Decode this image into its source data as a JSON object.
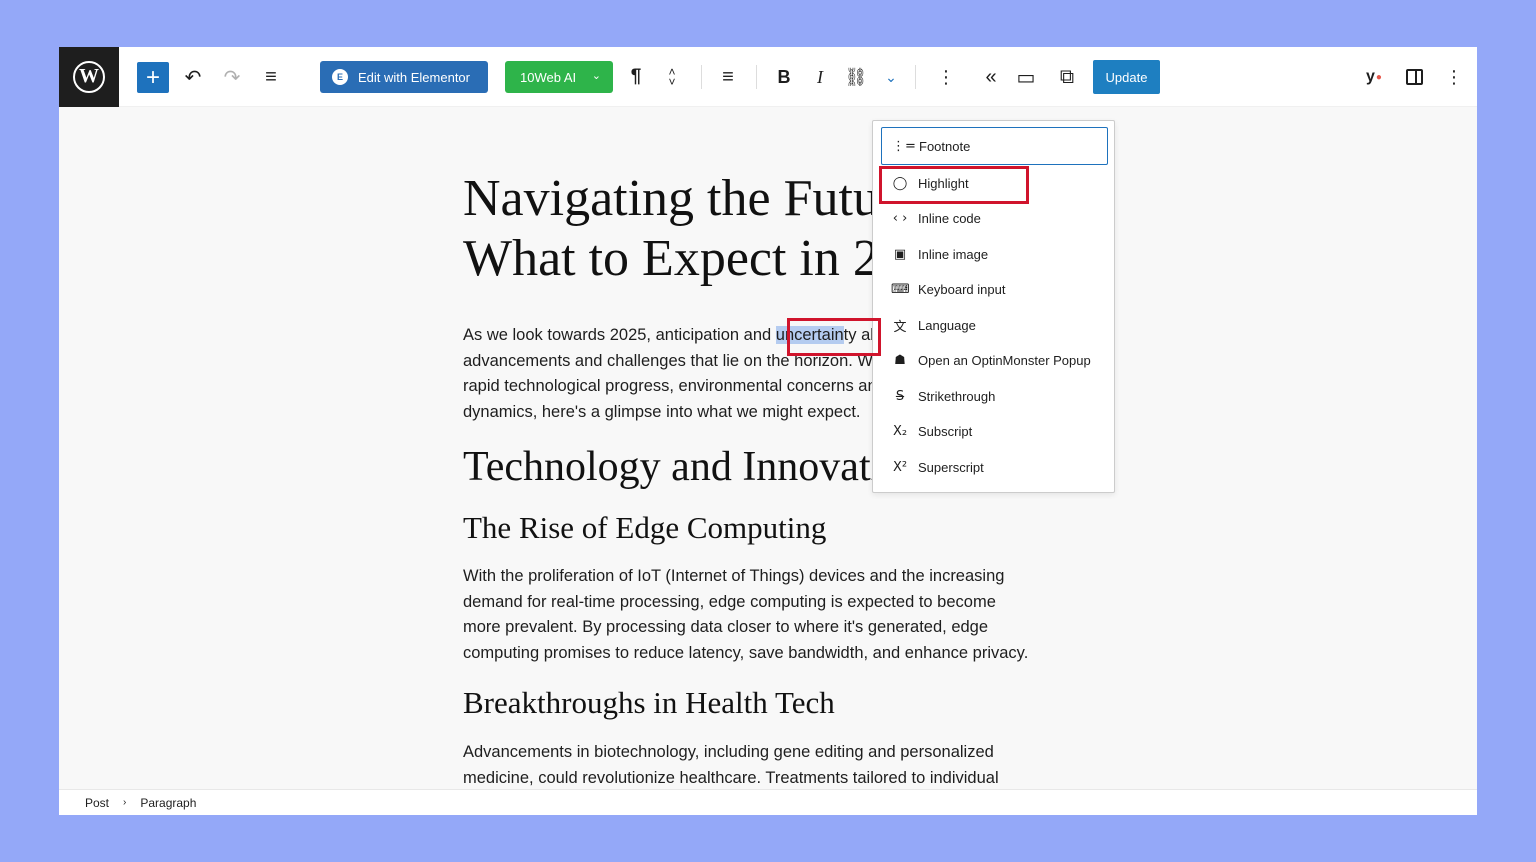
{
  "toolbar": {
    "add_icon": "+",
    "undo_icon": "↶",
    "redo_icon": "↷",
    "outline_icon": "≡",
    "elementor_label": "Edit with Elementor",
    "ai_label": "10Web AI",
    "ai_caret": "⌄",
    "paragraph_icon": "¶",
    "move_up": "˄",
    "move_down": "˅",
    "align_icon": "≡",
    "bold": "B",
    "italic": "I",
    "link_icon": "⛓",
    "more_fmt_icon": "⌄",
    "kebab_icon": "⋮",
    "collapse_icon": "«",
    "preview_icon": "▭",
    "external_icon": "⧉",
    "update_label": "Update",
    "yoast_label": "y",
    "yoast_dot": "●",
    "options_icon": "⋮"
  },
  "post": {
    "title": "Navigating the Future:\nWhat to Expect in 2025",
    "paragraph1_before": "As we look towards 2025, anticipation and ",
    "paragraph1_selected": "uncertain",
    "paragraph1_after": "ty about the\nadvancements and challenges that lie on the horizon. With\nrapid technological progress, environmental concerns and\ndynamics, here's a glimpse into what we might expect.",
    "heading2": "Technology and Innovation",
    "heading3a": "The Rise of Edge Computing",
    "paragraph2": "With the proliferation of IoT (Internet of Things) devices and the increasing\ndemand for real-time processing, edge computing is expected to become\nmore prevalent. By processing data closer to where it's generated, edge\ncomputing promises to reduce latency, save bandwidth, and enhance privacy.",
    "heading3b": "Breakthroughs in Health Tech",
    "paragraph3": "Advancements in biotechnology, including gene editing and personalized\nmedicine, could revolutionize healthcare. Treatments tailored to individual"
  },
  "dropdown": {
    "items": [
      {
        "label": "Footnote",
        "icon": "⋮="
      },
      {
        "label": "Highlight",
        "icon": "◯"
      },
      {
        "label": "Inline code",
        "icon": "‹ ›"
      },
      {
        "label": "Inline image",
        "icon": "▣"
      },
      {
        "label": "Keyboard input",
        "icon": "⌨"
      },
      {
        "label": "Language",
        "icon": "文"
      },
      {
        "label": "Open an OptinMonster Popup",
        "icon": "☗"
      },
      {
        "label": "Strikethrough",
        "icon": "S̶"
      },
      {
        "label": "Subscript",
        "icon": "X₂"
      },
      {
        "label": "Superscript",
        "icon": "X²"
      }
    ]
  },
  "footer": {
    "crumb1": "Post",
    "separator": "›",
    "crumb2": "Paragraph"
  }
}
